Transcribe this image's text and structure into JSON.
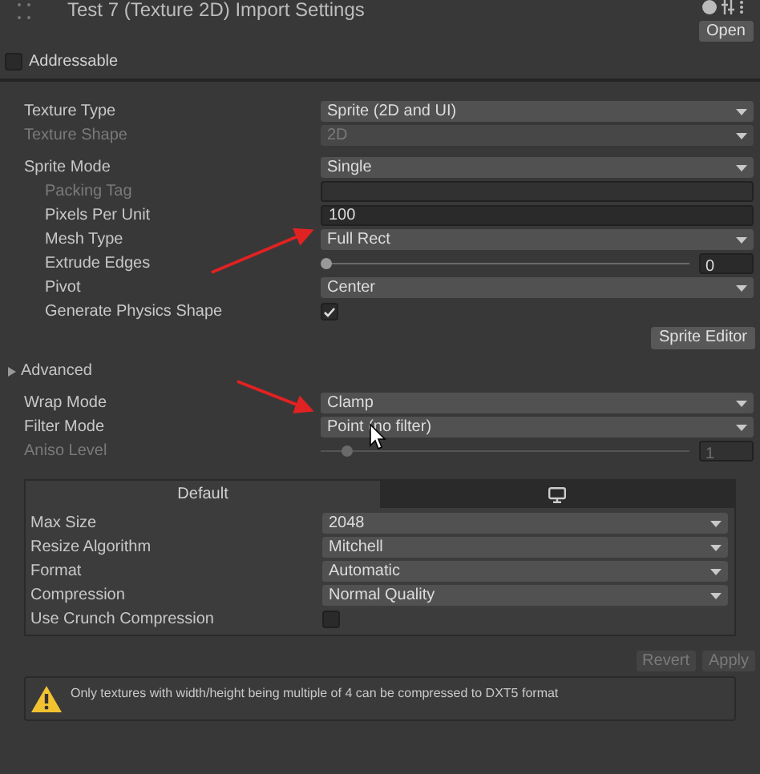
{
  "window": {
    "title": "Test 7 (Texture 2D) Import Settings",
    "open_button": "Open"
  },
  "addressable": {
    "label": "Addressable",
    "checked": false
  },
  "sections": [
    {
      "rows": [
        {
          "kind": "dropdown",
          "label": "Texture Type",
          "value": "Sprite (2D and UI)",
          "disabled": false
        },
        {
          "kind": "dropdown",
          "label": "Texture Shape",
          "value": "2D",
          "disabled": true
        }
      ]
    },
    {
      "rows": [
        {
          "kind": "dropdown",
          "label": "Sprite Mode",
          "value": "Single",
          "disabled": false,
          "children": [
            {
              "kind": "text",
              "label": "Packing Tag",
              "disabled": true
            },
            {
              "kind": "text",
              "label": "Pixels Per Unit",
              "value": "100",
              "disabled": false
            },
            {
              "kind": "dropdown",
              "label": "Mesh Type",
              "value": "Full Rect",
              "disabled": false
            },
            {
              "kind": "slider",
              "label": "Extrude Edges",
              "level": 0,
              "reading": "0",
              "disabled": false
            },
            {
              "kind": "dropdown",
              "label": "Pivot",
              "value": "Center",
              "disabled": false
            },
            {
              "kind": "checkbox",
              "label": "Generate Physics Shape",
              "checked": true,
              "disabled": false
            }
          ]
        },
        {
          "kind": "button",
          "label": "Sprite Editor"
        }
      ]
    },
    {
      "rows": [
        {
          "kind": "foldout",
          "label": "Advanced",
          "expanded": false
        }
      ]
    },
    {
      "rows": [
        {
          "kind": "dropdown",
          "label": "Wrap Mode",
          "value": "Clamp",
          "disabled": false
        },
        {
          "kind": "dropdown",
          "label": "Filter Mode",
          "value": "Point (no filter)",
          "disabled": false
        },
        {
          "kind": "slider",
          "label": "Aniso Level",
          "level": 0.06,
          "reading": "1",
          "disabled": true
        }
      ]
    }
  ],
  "platform": {
    "tabs": [
      {
        "kind": "text",
        "label": "Default",
        "selected": true
      },
      {
        "kind": "monitor",
        "selected": false
      }
    ],
    "rows": [
      {
        "kind": "dropdown",
        "label": "Max Size",
        "value": "2048",
        "disabled": false
      },
      {
        "kind": "dropdown",
        "label": "Resize Algorithm",
        "value": "Mitchell",
        "disabled": false
      },
      {
        "kind": "dropdown",
        "label": "Format",
        "value": "Automatic",
        "disabled": false
      },
      {
        "kind": "dropdown",
        "label": "Compression",
        "value": "Normal Quality",
        "disabled": false
      },
      {
        "kind": "checkbox",
        "label": "Use Crunch Compression",
        "checked": false,
        "disabled": false
      }
    ]
  },
  "buttons": [
    {
      "label": "Revert",
      "disabled": true
    },
    {
      "label": "Apply",
      "disabled": true
    }
  ],
  "warning": {
    "text": "Only textures with width/height being multiple of 4 can be compressed to DXT5 format"
  }
}
